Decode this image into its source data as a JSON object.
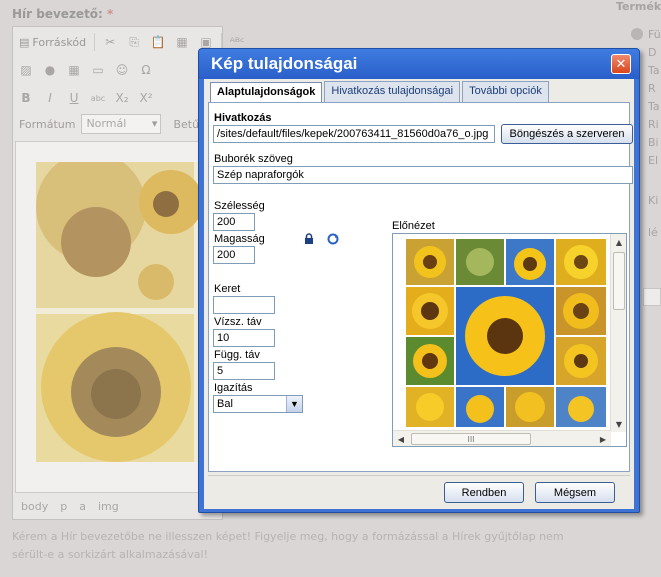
{
  "background": {
    "field_label": "Hír bevezető:",
    "required_mark": "*",
    "toolbar": {
      "source_label": "Forráskód",
      "format_label": "Formátum",
      "format_value": "Normál",
      "font_label": "Betűt"
    },
    "statusbar": [
      "body",
      "p",
      "a",
      "img"
    ],
    "note_html_text": "Kérem a Hír bevezetőbe ne illesszen képet! Figyelje meg, hogy a formázással a Hírek gyűjtőlap nem sérült-e a sorkizárt alkalmazásával!",
    "right_panel_title": "Terméke",
    "right_panel_items": [
      "Fü",
      "D",
      "Ta",
      "R",
      "Ta",
      "Ri",
      "Bi",
      "El",
      "Ki",
      "lé"
    ]
  },
  "dialog": {
    "title": "Kép tulajdonságai",
    "close_glyph": "✕",
    "tabs": [
      {
        "label": "Alaptulajdonságok",
        "active": true
      },
      {
        "label": "Hivatkozás tulajdonságai",
        "active": false
      },
      {
        "label": "További opciók",
        "active": false
      }
    ],
    "url_label": "Hivatkozás",
    "url_value": "/sites/default/files/kepek/200763411_81560d0a76_o.jpg",
    "browse_button": "Böngészés a szerveren",
    "alt_label": "Buborék szöveg",
    "alt_value": "Szép napraforgók",
    "width_label": "Szélesség",
    "width_value": "200",
    "height_label": "Magasság",
    "height_value": "200",
    "border_label": "Keret",
    "border_value": "",
    "hspace_label": "Vízsz. táv",
    "hspace_value": "10",
    "vspace_label": "Függ. táv",
    "vspace_value": "5",
    "align_label": "Igazítás",
    "align_value": "Bal",
    "preview_label": "Előnézet",
    "ok_button": "Rendben",
    "cancel_button": "Mégsem",
    "hscroll_grip": "III"
  },
  "colors": {
    "title_bar": "#2a5fc9",
    "close_button": "#d9461e",
    "frame": "#3f74d4"
  }
}
